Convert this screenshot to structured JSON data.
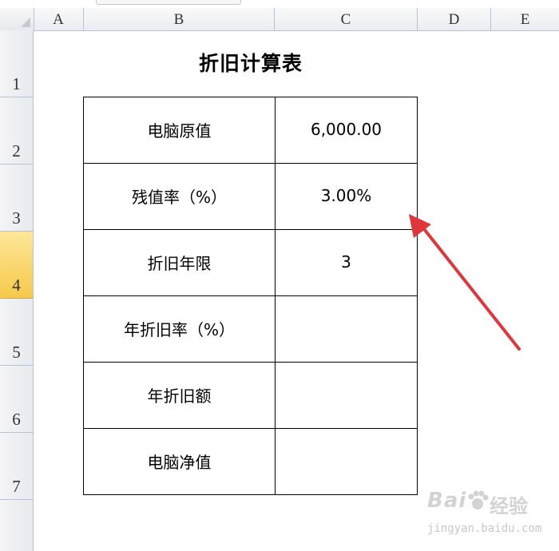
{
  "columns": [
    "A",
    "B",
    "C",
    "D",
    "E"
  ],
  "rows": [
    "1",
    "2",
    "3",
    "4",
    "5",
    "6",
    "7"
  ],
  "active_row": "4",
  "title": "折旧计算表",
  "table": [
    {
      "label": "电脑原值",
      "value": "6,000.00"
    },
    {
      "label": "残值率（%）",
      "value": "3.00%"
    },
    {
      "label": "折旧年限",
      "value": "3"
    },
    {
      "label": "年折旧率（%）",
      "value": ""
    },
    {
      "label": "年折旧额",
      "value": ""
    },
    {
      "label": "电脑净值",
      "value": ""
    }
  ],
  "watermark": {
    "brand": "Bai",
    "suffix": "经验",
    "url": "jingyan.baidu.com"
  },
  "colors": {
    "arrow": "#e0353b",
    "active_row_header": "#f6c94a",
    "grid_header": "#e9edf2"
  }
}
